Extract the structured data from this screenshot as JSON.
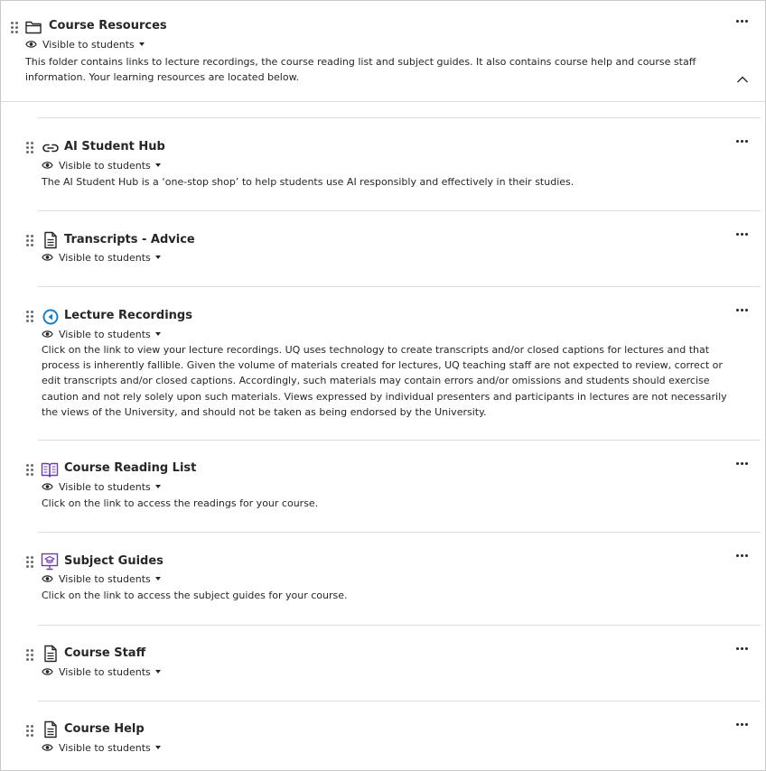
{
  "folder": {
    "title": "Course Resources",
    "visibility": "Visible to students",
    "description": "This folder contains links to lecture recordings, the course reading list and subject guides. It also contains course help and course staff information. Your learning resources are located below."
  },
  "items": [
    {
      "title": "AI Student Hub",
      "icon": "link-icon",
      "visibility": "Visible to students",
      "description": "The AI Student Hub is a ‘one-stop shop’ to help students use AI responsibly and effectively in their studies."
    },
    {
      "title": "Transcripts - Advice",
      "icon": "document-icon",
      "visibility": "Visible to students",
      "description": ""
    },
    {
      "title": "Lecture Recordings",
      "icon": "lecture-recording-icon",
      "visibility": "Visible to students",
      "description": "Click on the link to view your lecture recordings. UQ uses technology to create transcripts and/or closed captions for lectures and that process is inherently fallible. Given the volume of materials created for lectures, UQ teaching staff are not expected to review, correct or edit transcripts and/or closed captions. Accordingly, such materials may contain errors and/or omissions and students should exercise caution and not rely solely upon such materials. Views expressed by individual presenters and participants in lectures are not necessarily the views of the University, and should not be taken as being endorsed by the University."
    },
    {
      "title": "Course Reading List",
      "icon": "reading-list-icon",
      "visibility": "Visible to students",
      "description": "Click on the link to access the readings for your course."
    },
    {
      "title": "Subject Guides",
      "icon": "subject-guides-icon",
      "visibility": "Visible to students",
      "description": "Click on the link to access the subject guides for your course."
    },
    {
      "title": "Course Staff",
      "icon": "document-icon",
      "visibility": "Visible to students",
      "description": ""
    },
    {
      "title": "Course Help",
      "icon": "document-icon",
      "visibility": "Visible to students",
      "description": ""
    }
  ],
  "colors": {
    "text": "#262626",
    "divider": "#dcdcdc",
    "lecture_icon": "#1a7fc1",
    "purple_icon": "#6d3fa0"
  }
}
